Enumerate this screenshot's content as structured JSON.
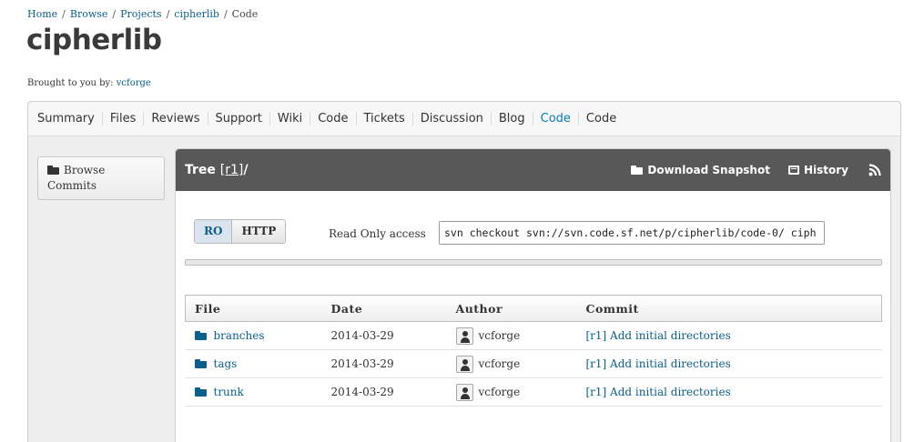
{
  "breadcrumb": {
    "items": [
      "Home",
      "Browse",
      "Projects",
      "cipherlib"
    ],
    "current": "Code",
    "separator": "/"
  },
  "project": {
    "title": "cipherlib",
    "brought_label": "Brought to you by:",
    "brought_by": "vcforge"
  },
  "tabs": [
    "Summary",
    "Files",
    "Reviews",
    "Support",
    "Wiki",
    "Code",
    "Tickets",
    "Discussion",
    "Blog",
    "Code",
    "Code"
  ],
  "active_tab_index": 9,
  "sidebar": {
    "browse_commits": "Browse Commits"
  },
  "panel": {
    "tree_label": "Tree",
    "revision": "[r1]",
    "tree_suffix": "/",
    "download_snapshot": "Download Snapshot",
    "history": "History"
  },
  "checkout": {
    "protocols": [
      "RO",
      "HTTP"
    ],
    "selected_protocol": "RO",
    "access_label": "Read Only access",
    "command": "svn checkout svn://svn.code.sf.net/p/cipherlib/code-0/ ciph"
  },
  "table": {
    "headers": [
      "File",
      "Date",
      "Author",
      "Commit"
    ],
    "rows": [
      {
        "file": "branches",
        "date": "2014-03-29",
        "author": "vcforge",
        "commit": "[r1] Add initial directories"
      },
      {
        "file": "tags",
        "date": "2014-03-29",
        "author": "vcforge",
        "commit": "[r1] Add initial directories"
      },
      {
        "file": "trunk",
        "date": "2014-03-29",
        "author": "vcforge",
        "commit": "[r1] Add initial directories"
      }
    ]
  },
  "colors": {
    "link": "#0b5f8a",
    "active_tab": "#0b7bb5",
    "panel_header": "#585858"
  }
}
